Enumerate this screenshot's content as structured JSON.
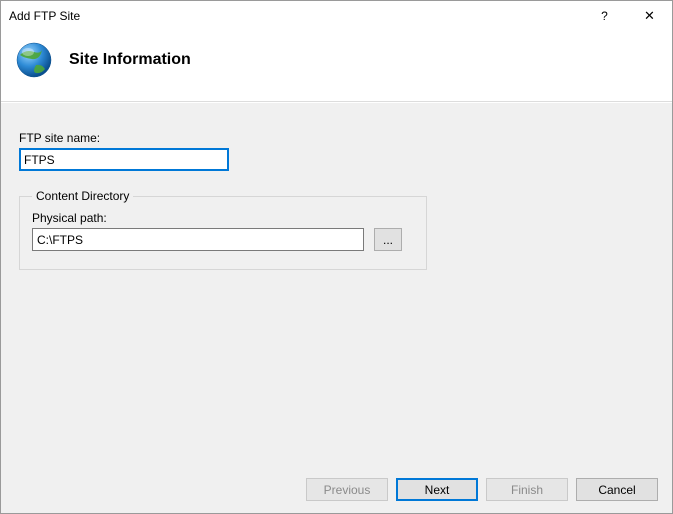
{
  "window": {
    "title": "Add FTP Site",
    "help_glyph": "?",
    "close_glyph": "✕"
  },
  "header": {
    "title": "Site Information"
  },
  "form": {
    "site_name_label": "FTP site name:",
    "site_name_value": "FTPS",
    "group_legend": "Content Directory",
    "physical_path_label": "Physical path:",
    "physical_path_value": "C:\\FTPS",
    "browse_label": "..."
  },
  "footer": {
    "previous": "Previous",
    "next": "Next",
    "finish": "Finish",
    "cancel": "Cancel"
  }
}
